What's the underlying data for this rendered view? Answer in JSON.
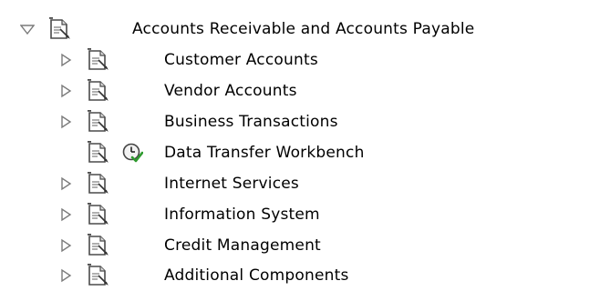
{
  "tree": {
    "root": {
      "label": "Accounts Receivable and Accounts Payable",
      "expanded": true,
      "icon": "document-folder-icon"
    },
    "children": [
      {
        "label": "Customer Accounts",
        "expanded": false,
        "icon": "document-folder-icon"
      },
      {
        "label": "Vendor Accounts",
        "expanded": false,
        "icon": "document-folder-icon"
      },
      {
        "label": "Business Transactions",
        "expanded": false,
        "icon": "document-folder-icon"
      },
      {
        "label": "Data Transfer Workbench",
        "leaf": true,
        "icon": "document-folder-icon",
        "extra_icon": "transaction-clock-icon"
      },
      {
        "label": "Internet Services",
        "expanded": false,
        "icon": "document-folder-icon"
      },
      {
        "label": "Information System",
        "expanded": false,
        "icon": "document-folder-icon"
      },
      {
        "label": "Credit Management",
        "expanded": false,
        "icon": "document-folder-icon"
      },
      {
        "label": "Additional Components",
        "expanded": false,
        "icon": "document-folder-icon"
      }
    ]
  },
  "colors": {
    "toggle": "#7a7a7a",
    "doc_stroke": "#4a4a4a",
    "doc_fold": "#dcdcdc",
    "clock_face": "#f2f2f2",
    "check": "#2e9a2e"
  }
}
